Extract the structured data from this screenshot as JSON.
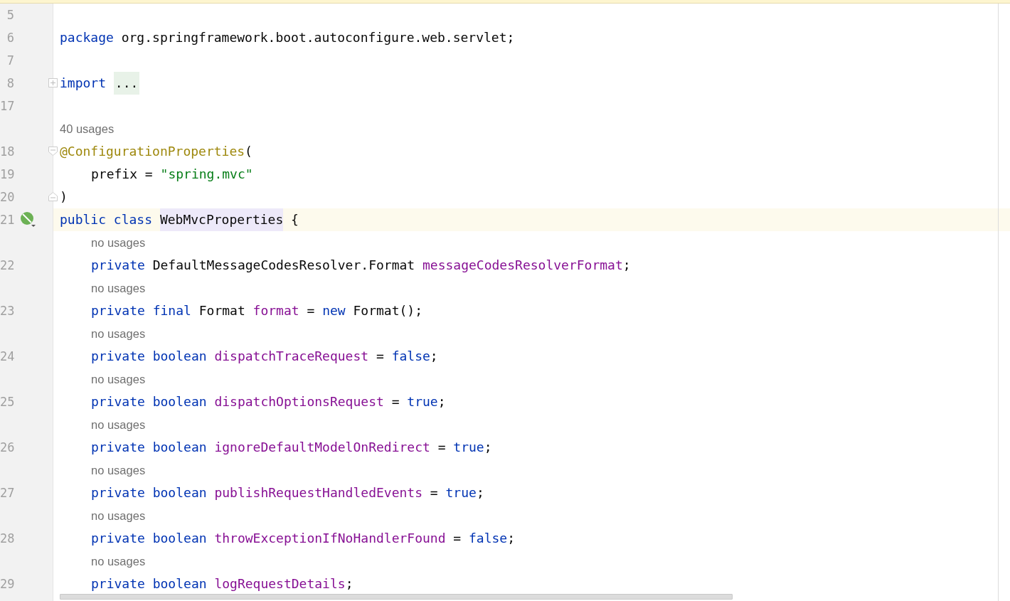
{
  "editor": {
    "lines": [
      {
        "kind": "code",
        "number": "5",
        "current": false
      },
      {
        "kind": "code",
        "number": "6",
        "current": false,
        "tokens": [
          {
            "kind": "keyword",
            "text": "package"
          },
          {
            "kind": "plain",
            "text": " org.springframework.boot.autoconfigure.web.servlet;"
          }
        ]
      },
      {
        "kind": "code",
        "number": "7",
        "current": false
      },
      {
        "kind": "code",
        "number": "8",
        "current": false,
        "fold": {
          "kind": "collapsed"
        },
        "tokens": [
          {
            "kind": "keyword",
            "text": "import"
          },
          {
            "kind": "folded",
            "text": "..."
          }
        ]
      },
      {
        "kind": "code",
        "number": "17",
        "current": false
      },
      {
        "kind": "hint",
        "text": "40 usages"
      },
      {
        "kind": "code",
        "number": "18",
        "current": false,
        "fold": {
          "kind": "start"
        },
        "tokens": [
          {
            "kind": "annotation",
            "text": "@ConfigurationProperties"
          },
          {
            "kind": "plain",
            "text": "("
          }
        ],
        "children": [
          {
            "kind": "code",
            "number": "19",
            "current": false,
            "tokens": [
              {
                "kind": "plain",
                "text": "prefix = "
              },
              {
                "kind": "string",
                "text": "\"spring.mvc\""
              }
            ]
          }
        ]
      },
      {
        "kind": "code",
        "number": "20",
        "current": false,
        "fold": {
          "kind": "end"
        },
        "tokens": [
          {
            "kind": "plain",
            "text": ")"
          }
        ]
      },
      {
        "kind": "code",
        "number": "21",
        "current": true,
        "gutter_icon": {
          "kind": "bean"
        },
        "tokens": [
          {
            "kind": "keyword",
            "text": "public class"
          },
          {
            "kind": "highlight",
            "text": "WebMvcProperties"
          },
          {
            "kind": "plain",
            "text": " {"
          }
        ],
        "children": [
          {
            "kind": "hint",
            "text": "no usages"
          },
          {
            "kind": "code",
            "number": "22",
            "current": false,
            "tokens": [
              {
                "kind": "keyword",
                "text": "private"
              },
              {
                "kind": "plain",
                "text": " DefaultMessageCodesResolver.Format "
              },
              {
                "kind": "field",
                "text": "messageCodesResolverFormat"
              },
              {
                "kind": "plain",
                "text": ";"
              }
            ]
          },
          {
            "kind": "hint",
            "text": "no usages"
          },
          {
            "kind": "code",
            "number": "23",
            "current": false,
            "tokens": [
              {
                "kind": "keyword",
                "text": "private final"
              },
              {
                "kind": "plain",
                "text": " Format "
              },
              {
                "kind": "field",
                "text": "format"
              },
              {
                "kind": "plain",
                "text": " = "
              },
              {
                "kind": "keyword",
                "text": "new"
              },
              {
                "kind": "plain",
                "text": " Format();"
              }
            ]
          },
          {
            "kind": "hint",
            "text": "no usages"
          },
          {
            "kind": "code",
            "number": "24",
            "current": false,
            "tokens": [
              {
                "kind": "keyword",
                "text": "private boolean"
              },
              {
                "kind": "field",
                "text": "dispatchTraceRequest"
              },
              {
                "kind": "plain",
                "text": " = "
              },
              {
                "kind": "keyword",
                "text": "false"
              },
              {
                "kind": "plain",
                "text": ";"
              }
            ]
          },
          {
            "kind": "hint",
            "text": "no usages"
          },
          {
            "kind": "code",
            "number": "25",
            "current": false,
            "tokens": [
              {
                "kind": "keyword",
                "text": "private boolean"
              },
              {
                "kind": "field",
                "text": "dispatchOptionsRequest"
              },
              {
                "kind": "plain",
                "text": " = "
              },
              {
                "kind": "keyword",
                "text": "true"
              },
              {
                "kind": "plain",
                "text": ";"
              }
            ]
          },
          {
            "kind": "hint",
            "text": "no usages"
          },
          {
            "kind": "code",
            "number": "26",
            "current": false,
            "tokens": [
              {
                "kind": "keyword",
                "text": "private boolean"
              },
              {
                "kind": "field",
                "text": "ignoreDefaultModelOnRedirect"
              },
              {
                "kind": "plain",
                "text": " = "
              },
              {
                "kind": "keyword",
                "text": "true"
              },
              {
                "kind": "plain",
                "text": ";"
              }
            ]
          },
          {
            "kind": "hint",
            "text": "no usages"
          },
          {
            "kind": "code",
            "number": "27",
            "current": false,
            "tokens": [
              {
                "kind": "keyword",
                "text": "private boolean"
              },
              {
                "kind": "field",
                "text": "publishRequestHandledEvents"
              },
              {
                "kind": "plain",
                "text": " = "
              },
              {
                "kind": "keyword",
                "text": "true"
              },
              {
                "kind": "plain",
                "text": ";"
              }
            ]
          },
          {
            "kind": "hint",
            "text": "no usages"
          },
          {
            "kind": "code",
            "number": "28",
            "current": false,
            "tokens": [
              {
                "kind": "keyword",
                "text": "private boolean"
              },
              {
                "kind": "field",
                "text": "throwExceptionIfNoHandlerFound"
              },
              {
                "kind": "plain",
                "text": " = "
              },
              {
                "kind": "keyword",
                "text": "false"
              },
              {
                "kind": "plain",
                "text": ";"
              }
            ]
          },
          {
            "kind": "hint",
            "text": "no usages"
          },
          {
            "kind": "code",
            "number": "29",
            "current": false,
            "tokens": [
              {
                "kind": "keyword",
                "text": "private boolean"
              },
              {
                "kind": "field",
                "text": "logRequestDetails"
              },
              {
                "kind": "plain",
                "text": ";"
              }
            ]
          }
        ]
      }
    ]
  }
}
